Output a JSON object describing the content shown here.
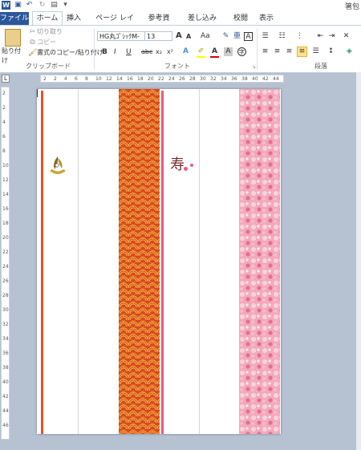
{
  "quick_access": {
    "save_icon": "save-icon",
    "undo_icon": "undo-icon",
    "redo_icon": "redo-icon"
  },
  "title_bar": {
    "doc_title": "箸包"
  },
  "tabs": {
    "file": "ファイル",
    "home": "ホーム",
    "insert": "挿入",
    "page_layout": "ページ レイアウト",
    "references": "参考資料",
    "mailings": "差し込み文書",
    "review": "校閲",
    "view": "表示"
  },
  "clipboard": {
    "paste": "貼り付け",
    "cut": "切り取り",
    "copy": "コピー",
    "format_painter": "書式のコピー/貼り付け",
    "group_label": "クリップボード"
  },
  "font": {
    "name": "HG丸ｺﾞｼｯｸM-",
    "size": "13",
    "bold": "B",
    "italic": "I",
    "underline": "U",
    "strike": "abc",
    "subscript": "x₂",
    "superscript": "x²",
    "group_label": "フォント",
    "grow": "A",
    "shrink": "A",
    "change_case": "Aa"
  },
  "paragraph": {
    "group_label": "段落"
  },
  "ruler": {
    "h_ticks": [
      "2",
      "2",
      "4",
      "6",
      "8",
      "10",
      "12",
      "14",
      "16",
      "18",
      "20",
      "22",
      "24",
      "26",
      "28",
      "30",
      "32",
      "34",
      "36",
      "38",
      "40",
      "42",
      "44"
    ],
    "v_ticks": [
      "2",
      "2",
      "4",
      "6",
      "8",
      "10",
      "12",
      "14",
      "16",
      "18",
      "20",
      "22",
      "24",
      "26",
      "28",
      "30",
      "32",
      "34",
      "36",
      "38",
      "40",
      "42",
      "44",
      "46"
    ],
    "corner": "L"
  },
  "colors": {
    "ribbon_blue": "#2b579a",
    "orange_stripe": "#e2542a",
    "pink_stripe": "#e95a7f",
    "wave_bg": "#d9491d",
    "wave_gold": "#f0b83c",
    "sakura_bg": "#f3a9bb"
  },
  "page": {
    "glyph_kotobuki": "寿"
  }
}
